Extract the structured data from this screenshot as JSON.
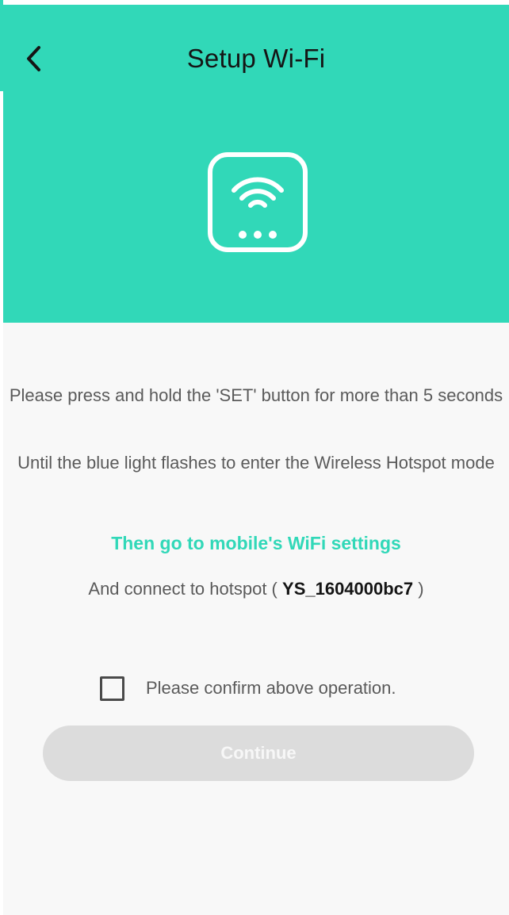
{
  "header": {
    "title": "Setup Wi-Fi",
    "back_icon": "chevron-left-icon",
    "device_icon": "wifi-router-icon",
    "background_color": "#31d8b8"
  },
  "instructions": {
    "line1": "Please press and hold the 'SET' button for more than 5 seconds",
    "line2": "Until the blue light flashes to enter the Wireless Hotspot mode",
    "wifi_settings_link": "Then go to mobile's WiFi settings",
    "hotspot_prefix": "And connect to hotspot (",
    "hotspot_name": "YS_1604000bc7",
    "hotspot_suffix": ")"
  },
  "confirm": {
    "label": "Please confirm above operation.",
    "checked": false
  },
  "continue_button": {
    "label": "Continue",
    "enabled": false
  },
  "colors": {
    "accent": "#31d8b8",
    "text": "#5a5a5a",
    "title": "#151515",
    "button_disabled": "#dcdcdc"
  }
}
